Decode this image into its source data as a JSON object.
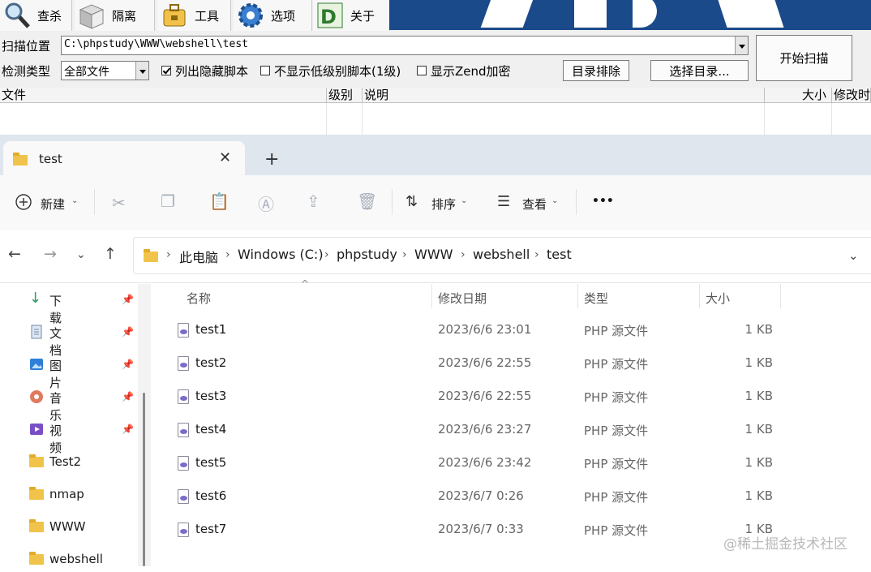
{
  "dshield": {
    "toolbar": [
      {
        "label": "查杀",
        "icon": "magnifier-icon"
      },
      {
        "label": "隔离",
        "icon": "box-icon"
      },
      {
        "label": "工具",
        "icon": "toolbox-icon"
      },
      {
        "label": "选项",
        "icon": "gear-icon"
      },
      {
        "label": "关于",
        "icon": "d-logo-icon"
      }
    ],
    "scan_path_label": "扫描位置",
    "scan_path_value": "C:\\phpstudy\\WWW\\webshell\\test",
    "detect_type_label": "检测类型",
    "detect_type_value": "全部文件",
    "checkboxes": [
      {
        "label": "列出隐藏脚本",
        "checked": true
      },
      {
        "label": "不显示低级别脚本(1级)",
        "checked": false
      },
      {
        "label": "显示Zend加密",
        "checked": false
      }
    ],
    "exclude_dir_button": "目录排除",
    "select_dir_button": "选择目录...",
    "start_scan_button": "开始扫描",
    "columns": [
      "文件",
      "级别",
      "说明",
      "大小",
      "修改时"
    ]
  },
  "explorer": {
    "tab_title": "test",
    "toolbar": {
      "new_label": "新建",
      "sort_label": "排序",
      "view_label": "查看",
      "more_label": "•••"
    },
    "breadcrumb": [
      "此电脑",
      "Windows (C:)",
      "phpstudy",
      "WWW",
      "webshell",
      "test"
    ],
    "sidebar": [
      {
        "label": "下载",
        "icon": "download-icon",
        "pinned": true
      },
      {
        "label": "文档",
        "icon": "document-icon",
        "pinned": true
      },
      {
        "label": "图片",
        "icon": "pictures-icon",
        "pinned": true
      },
      {
        "label": "音乐",
        "icon": "music-icon",
        "pinned": true
      },
      {
        "label": "视频",
        "icon": "video-icon",
        "pinned": true
      },
      {
        "label": "Test2",
        "icon": "folder-icon",
        "pinned": false
      },
      {
        "label": "nmap",
        "icon": "folder-icon",
        "pinned": false
      },
      {
        "label": "WWW",
        "icon": "folder-icon",
        "pinned": false
      },
      {
        "label": "webshell",
        "icon": "folder-icon",
        "pinned": false
      }
    ],
    "columns": {
      "name": "名称",
      "date": "修改日期",
      "type": "类型",
      "size": "大小"
    },
    "files": [
      {
        "name": "test1",
        "date": "2023/6/6 23:01",
        "type": "PHP 源文件",
        "size": "1 KB"
      },
      {
        "name": "test2",
        "date": "2023/6/6 22:55",
        "type": "PHP 源文件",
        "size": "1 KB"
      },
      {
        "name": "test3",
        "date": "2023/6/6 22:55",
        "type": "PHP 源文件",
        "size": "1 KB"
      },
      {
        "name": "test4",
        "date": "2023/6/6 23:27",
        "type": "PHP 源文件",
        "size": "1 KB"
      },
      {
        "name": "test5",
        "date": "2023/6/6 23:42",
        "type": "PHP 源文件",
        "size": "1 KB"
      },
      {
        "name": "test6",
        "date": "2023/6/7 0:26",
        "type": "PHP 源文件",
        "size": "1 KB"
      },
      {
        "name": "test7",
        "date": "2023/6/7 0:33",
        "type": "PHP 源文件",
        "size": "1 KB"
      }
    ]
  },
  "watermark": "@稀土掘金技术社区"
}
